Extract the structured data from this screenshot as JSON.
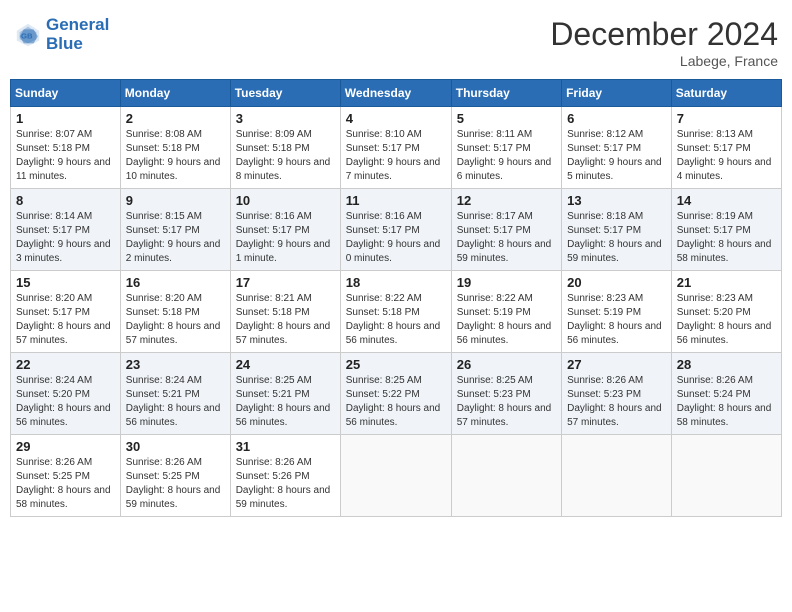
{
  "header": {
    "logo_line1": "General",
    "logo_line2": "Blue",
    "month": "December 2024",
    "location": "Labege, France"
  },
  "weekdays": [
    "Sunday",
    "Monday",
    "Tuesday",
    "Wednesday",
    "Thursday",
    "Friday",
    "Saturday"
  ],
  "weeks": [
    [
      {
        "day": "1",
        "sunrise": "8:07 AM",
        "sunset": "5:18 PM",
        "daylight": "9 hours and 11 minutes."
      },
      {
        "day": "2",
        "sunrise": "8:08 AM",
        "sunset": "5:18 PM",
        "daylight": "9 hours and 10 minutes."
      },
      {
        "day": "3",
        "sunrise": "8:09 AM",
        "sunset": "5:18 PM",
        "daylight": "9 hours and 8 minutes."
      },
      {
        "day": "4",
        "sunrise": "8:10 AM",
        "sunset": "5:17 PM",
        "daylight": "9 hours and 7 minutes."
      },
      {
        "day": "5",
        "sunrise": "8:11 AM",
        "sunset": "5:17 PM",
        "daylight": "9 hours and 6 minutes."
      },
      {
        "day": "6",
        "sunrise": "8:12 AM",
        "sunset": "5:17 PM",
        "daylight": "9 hours and 5 minutes."
      },
      {
        "day": "7",
        "sunrise": "8:13 AM",
        "sunset": "5:17 PM",
        "daylight": "9 hours and 4 minutes."
      }
    ],
    [
      {
        "day": "8",
        "sunrise": "8:14 AM",
        "sunset": "5:17 PM",
        "daylight": "9 hours and 3 minutes."
      },
      {
        "day": "9",
        "sunrise": "8:15 AM",
        "sunset": "5:17 PM",
        "daylight": "9 hours and 2 minutes."
      },
      {
        "day": "10",
        "sunrise": "8:16 AM",
        "sunset": "5:17 PM",
        "daylight": "9 hours and 1 minute."
      },
      {
        "day": "11",
        "sunrise": "8:16 AM",
        "sunset": "5:17 PM",
        "daylight": "9 hours and 0 minutes."
      },
      {
        "day": "12",
        "sunrise": "8:17 AM",
        "sunset": "5:17 PM",
        "daylight": "8 hours and 59 minutes."
      },
      {
        "day": "13",
        "sunrise": "8:18 AM",
        "sunset": "5:17 PM",
        "daylight": "8 hours and 59 minutes."
      },
      {
        "day": "14",
        "sunrise": "8:19 AM",
        "sunset": "5:17 PM",
        "daylight": "8 hours and 58 minutes."
      }
    ],
    [
      {
        "day": "15",
        "sunrise": "8:20 AM",
        "sunset": "5:17 PM",
        "daylight": "8 hours and 57 minutes."
      },
      {
        "day": "16",
        "sunrise": "8:20 AM",
        "sunset": "5:18 PM",
        "daylight": "8 hours and 57 minutes."
      },
      {
        "day": "17",
        "sunrise": "8:21 AM",
        "sunset": "5:18 PM",
        "daylight": "8 hours and 57 minutes."
      },
      {
        "day": "18",
        "sunrise": "8:22 AM",
        "sunset": "5:18 PM",
        "daylight": "8 hours and 56 minutes."
      },
      {
        "day": "19",
        "sunrise": "8:22 AM",
        "sunset": "5:19 PM",
        "daylight": "8 hours and 56 minutes."
      },
      {
        "day": "20",
        "sunrise": "8:23 AM",
        "sunset": "5:19 PM",
        "daylight": "8 hours and 56 minutes."
      },
      {
        "day": "21",
        "sunrise": "8:23 AM",
        "sunset": "5:20 PM",
        "daylight": "8 hours and 56 minutes."
      }
    ],
    [
      {
        "day": "22",
        "sunrise": "8:24 AM",
        "sunset": "5:20 PM",
        "daylight": "8 hours and 56 minutes."
      },
      {
        "day": "23",
        "sunrise": "8:24 AM",
        "sunset": "5:21 PM",
        "daylight": "8 hours and 56 minutes."
      },
      {
        "day": "24",
        "sunrise": "8:25 AM",
        "sunset": "5:21 PM",
        "daylight": "8 hours and 56 minutes."
      },
      {
        "day": "25",
        "sunrise": "8:25 AM",
        "sunset": "5:22 PM",
        "daylight": "8 hours and 56 minutes."
      },
      {
        "day": "26",
        "sunrise": "8:25 AM",
        "sunset": "5:23 PM",
        "daylight": "8 hours and 57 minutes."
      },
      {
        "day": "27",
        "sunrise": "8:26 AM",
        "sunset": "5:23 PM",
        "daylight": "8 hours and 57 minutes."
      },
      {
        "day": "28",
        "sunrise": "8:26 AM",
        "sunset": "5:24 PM",
        "daylight": "8 hours and 58 minutes."
      }
    ],
    [
      {
        "day": "29",
        "sunrise": "8:26 AM",
        "sunset": "5:25 PM",
        "daylight": "8 hours and 58 minutes."
      },
      {
        "day": "30",
        "sunrise": "8:26 AM",
        "sunset": "5:25 PM",
        "daylight": "8 hours and 59 minutes."
      },
      {
        "day": "31",
        "sunrise": "8:26 AM",
        "sunset": "5:26 PM",
        "daylight": "8 hours and 59 minutes."
      },
      null,
      null,
      null,
      null
    ]
  ],
  "labels": {
    "sunrise": "Sunrise:",
    "sunset": "Sunset:",
    "daylight": "Daylight:"
  }
}
